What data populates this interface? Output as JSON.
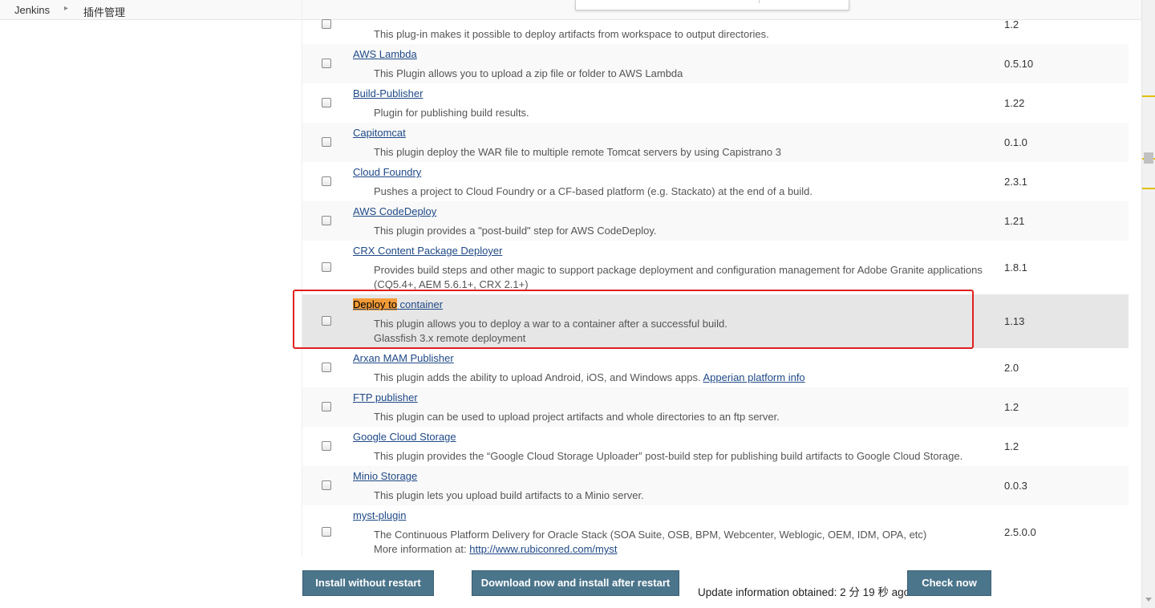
{
  "breadcrumb": {
    "home": "Jenkins",
    "current": "插件管理"
  },
  "plugins": [
    {
      "name": "",
      "desc": "This plug-in makes it possible to deploy artifacts from workspace to output directories.",
      "version": "1.2"
    },
    {
      "name": "AWS Lambda",
      "desc": "This Plugin allows you to upload a zip file or folder to AWS Lambda",
      "version": "0.5.10"
    },
    {
      "name": "Build-Publisher",
      "desc": "Plugin for publishing build results.",
      "version": "1.22"
    },
    {
      "name": "Capitomcat",
      "desc": "This plugin deploy the WAR file to multiple remote Tomcat servers by using Capistrano 3",
      "version": "0.1.0"
    },
    {
      "name": "Cloud Foundry",
      "desc": "Pushes a project to Cloud Foundry or a CF-based platform (e.g. Stackato) at the end of a build.",
      "version": "2.3.1"
    },
    {
      "name": "AWS CodeDeploy",
      "desc": "This plugin provides a \"post-build\" step for AWS CodeDeploy.",
      "version": "1.21"
    },
    {
      "name": "CRX Content Package Deployer",
      "desc": "Provides build steps and other magic to support package deployment and configuration management for Adobe Granite applications",
      "desc2": "(CQ5.4+, AEM 5.6.1+, CRX 2.1+)",
      "version": "1.8.1"
    },
    {
      "name_highlight": "Deploy to",
      "name_rest": "container",
      "desc": "This plugin allows you to deploy a war to a container after a successful build.",
      "desc2": "Glassfish 3.x remote deployment",
      "version": "1.13"
    },
    {
      "name": "Arxan MAM Publisher",
      "desc": "This plugin adds the ability to upload Android, iOS, and Windows apps.",
      "desc_link": "Apperian platform info",
      "version": "2.0"
    },
    {
      "name": "FTP publisher",
      "desc": "This plugin can be used to upload project artifacts and whole directories to an ftp server.",
      "version": "1.2"
    },
    {
      "name": "Google Cloud Storage",
      "desc": "This plugin provides the “Google Cloud Storage Uploader” post-build step for publishing build artifacts to Google Cloud Storage.",
      "version": "1.2"
    },
    {
      "name": "Minio Storage",
      "desc": "This plugin lets you upload build artifacts to a Minio server.",
      "version": "0.0.3"
    },
    {
      "name": "myst-plugin",
      "desc": "The Continuous Platform Delivery for Oracle Stack (SOA Suite, OSB, BPM, Webcenter, Weblogic, OEM, IDM, OPA, etc)",
      "desc2_prefix": "More information at:",
      "desc2_link": "http://www.rubiconred.com/myst",
      "version": "2.5.0.0"
    }
  ],
  "buttons": {
    "install_without_restart": "Install without restart",
    "download_install_after_restart": "Download now and install after restart",
    "check_now": "Check now"
  },
  "update_info": "Update information obtained: 2 分 19 秒 ago"
}
